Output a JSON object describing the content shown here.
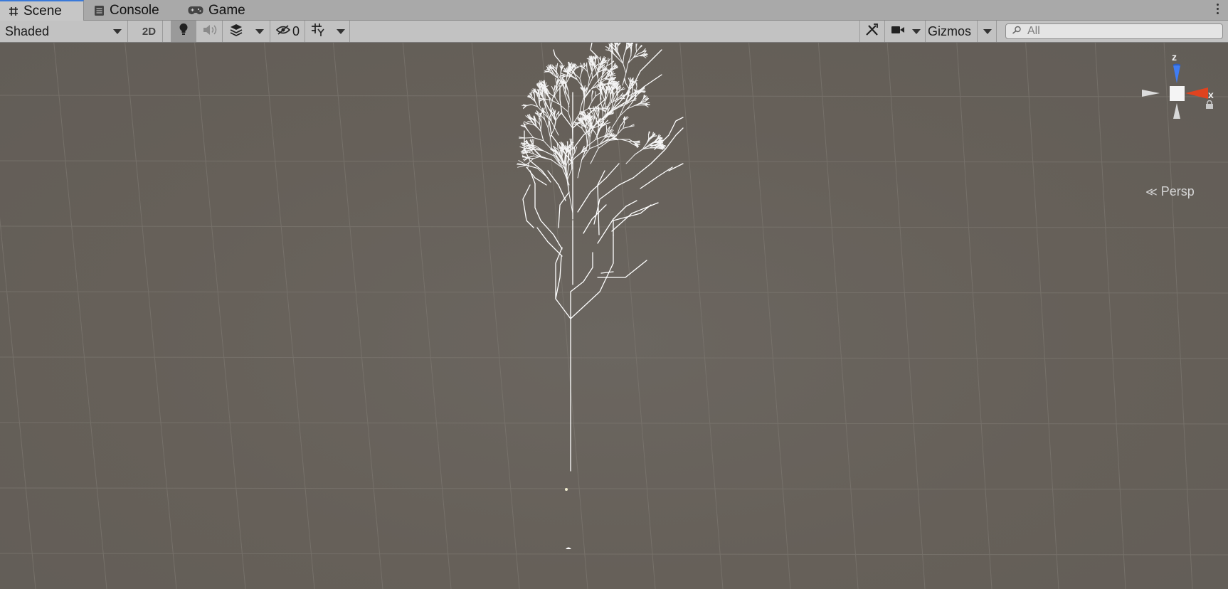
{
  "tabs": [
    {
      "label": "Scene",
      "icon": "grid-icon",
      "active": true
    },
    {
      "label": "Console",
      "icon": "console-icon",
      "active": false
    },
    {
      "label": "Game",
      "icon": "gamepad-icon",
      "active": false
    }
  ],
  "toolbar": {
    "draw_mode": "Shaded",
    "mode_2d": "2D",
    "hidden_count": "0",
    "gizmos": "Gizmos",
    "search_placeholder": "All"
  },
  "gizmo": {
    "z_label": "z",
    "x_label": "x",
    "projection": "Persp"
  },
  "colors": {
    "viewport_bg": "#666059",
    "toolbar_bg": "#c2c2c2",
    "tab_active_accent": "#3a79d9",
    "axis_z": "#3f7df5",
    "axis_x": "#e0431f",
    "tree_lines": "#ffffff"
  }
}
